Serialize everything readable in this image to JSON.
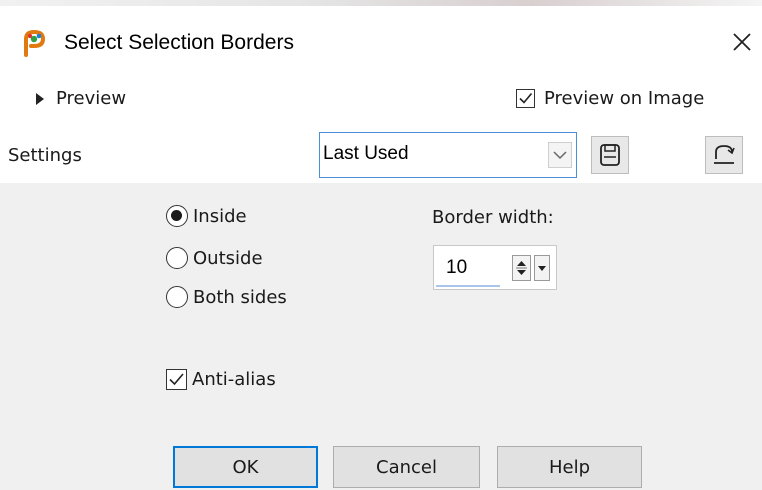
{
  "dialog": {
    "title": "Select Selection Borders",
    "app_icon": "paintshop-pro-icon",
    "close_icon": "close-icon"
  },
  "preview": {
    "toggle_label": "Preview",
    "preview_on_image_label": "Preview on Image",
    "preview_on_image_checked": true
  },
  "settings": {
    "label": "Settings",
    "preset_value": "Last Used",
    "save_icon": "save-preset-icon",
    "reset_icon": "reset-defaults-icon"
  },
  "options": {
    "radios": [
      {
        "label": "Inside",
        "selected": true
      },
      {
        "label": "Outside",
        "selected": false
      },
      {
        "label": "Both sides",
        "selected": false
      }
    ],
    "border_width_label": "Border width:",
    "border_width_value": "10",
    "anti_alias_label": "Anti-alias",
    "anti_alias_checked": true
  },
  "buttons": {
    "ok": "OK",
    "cancel": "Cancel",
    "help": "Help"
  },
  "colors": {
    "accent": "#0078d7",
    "combo_border": "#4a8fd8",
    "panel_bg": "#f0f0f0"
  }
}
